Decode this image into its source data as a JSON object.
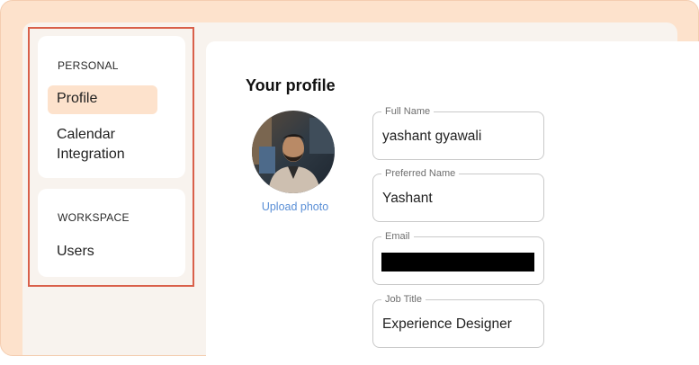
{
  "sidebar": {
    "personal": {
      "heading": "PERSONAL",
      "items": [
        {
          "label": "Profile",
          "active": true
        },
        {
          "label": "Calendar Integration",
          "active": false
        }
      ]
    },
    "workspace": {
      "heading": "WORKSPACE",
      "items": [
        {
          "label": "Users",
          "active": false
        }
      ]
    }
  },
  "main": {
    "title": "Your profile",
    "upload_photo": "Upload photo",
    "fields": {
      "full_name": {
        "label": "Full Name",
        "value": "yashant gyawali"
      },
      "preferred_name": {
        "label": "Preferred Name",
        "value": "Yashant"
      },
      "email": {
        "label": "Email",
        "value": "",
        "redacted": true
      },
      "job_title": {
        "label": "Job Title",
        "value": "Experience Designer"
      }
    }
  },
  "colors": {
    "frame_bg": "#fde2cc",
    "active_item_bg": "#fde2cc",
    "highlight_border": "#d9604a",
    "link": "#5a8fd6"
  }
}
